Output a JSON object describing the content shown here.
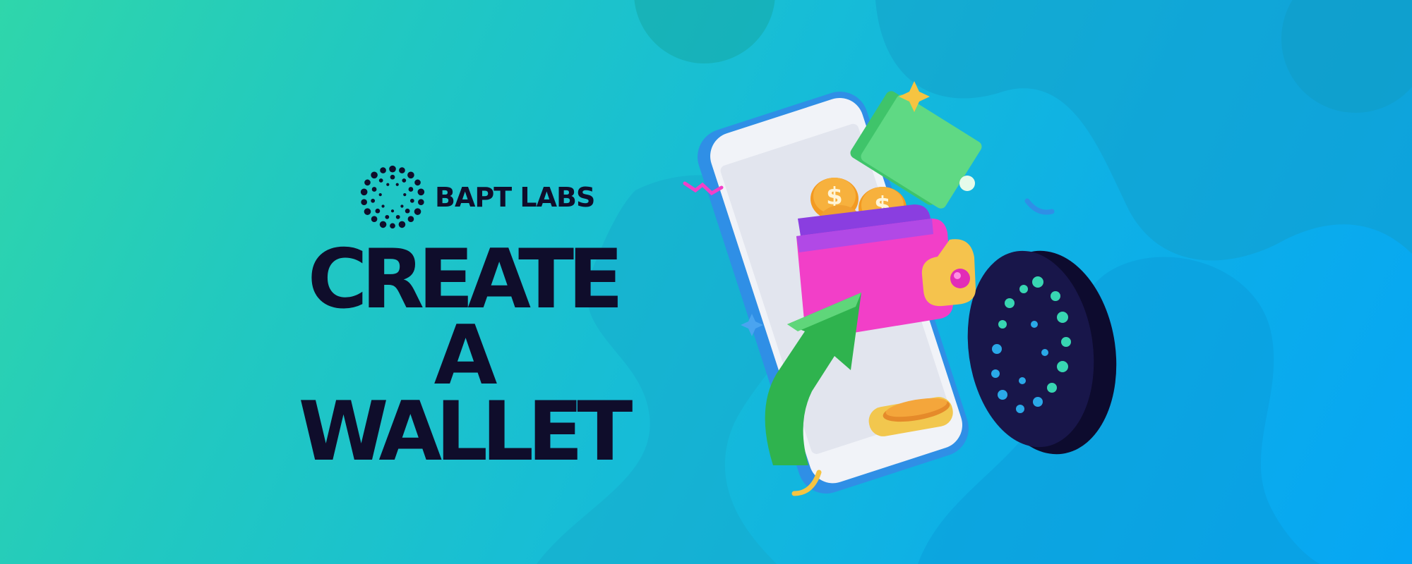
{
  "brand": {
    "name": "BAPT LABS",
    "logo_icon": "dotted-ring-logo-icon"
  },
  "headline": {
    "line1": "CREATE",
    "line2": "A WALLET"
  },
  "illustration": {
    "subject": "phone-wallet-money-icon",
    "icons": [
      "smartphone-icon",
      "wallet-icon",
      "coin-icon",
      "banknote-icon",
      "growth-arrow-icon",
      "token-coin-icon",
      "sparkle-icon"
    ]
  },
  "colors": {
    "background_start": "#2fd6ab",
    "background_end": "#06a6f4",
    "text_dark": "#0f0d2b",
    "wallet_pink": "#f23fc8",
    "wallet_purple": "#9a4ee8",
    "coin_orange": "#f4a32a",
    "cash_green": "#55d47a",
    "arrow_green": "#2fb34e",
    "token_navy": "#151340"
  }
}
